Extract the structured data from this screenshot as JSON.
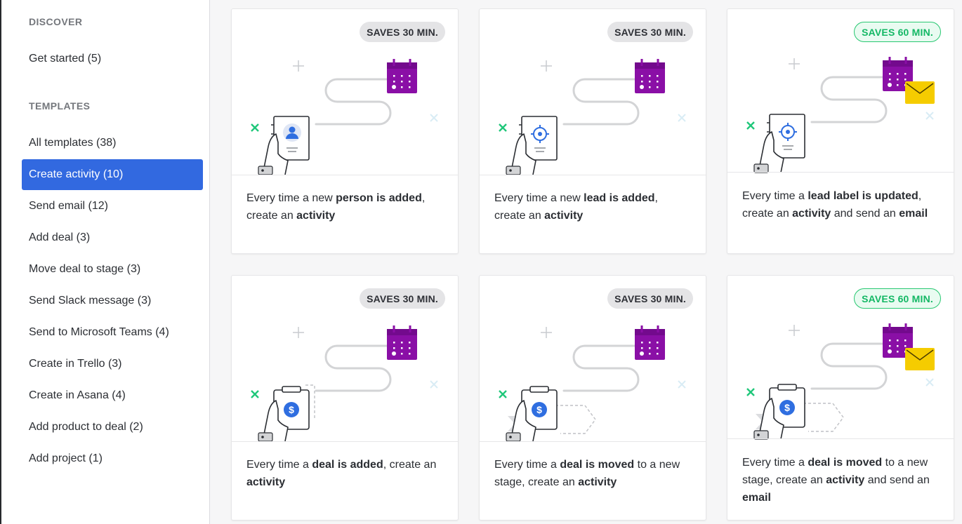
{
  "sidebar": {
    "discover_heading": "DISCOVER",
    "get_started": "Get started (5)",
    "templates_heading": "TEMPLATES",
    "items": [
      {
        "label": "All templates (38)",
        "active": false
      },
      {
        "label": "Create activity (10)",
        "active": true
      },
      {
        "label": "Send email (12)",
        "active": false
      },
      {
        "label": "Add deal (3)",
        "active": false
      },
      {
        "label": "Move deal to stage (3)",
        "active": false
      },
      {
        "label": "Send Slack message (3)",
        "active": false
      },
      {
        "label": "Send to Microsoft Teams (4)",
        "active": false
      },
      {
        "label": "Create in Trello (3)",
        "active": false
      },
      {
        "label": "Create in Asana (4)",
        "active": false
      },
      {
        "label": "Add product to deal (2)",
        "active": false
      },
      {
        "label": "Add project (1)",
        "active": false
      }
    ]
  },
  "colors": {
    "accent_blue": "#3269e0",
    "calendar_purple": "#8a0fa6",
    "email_yellow": "#f5cc00",
    "saves_green": "#14b865",
    "icon_blue": "#2f6ee0"
  },
  "cards": [
    {
      "badge": "SAVES 30 MIN.",
      "badge_style": "gray",
      "icon": "person-document-icon",
      "extra_email": false,
      "parts": [
        {
          "t": "Every time a new ",
          "b": false
        },
        {
          "t": "person is added",
          "b": true
        },
        {
          "t": ", create an ",
          "b": false
        },
        {
          "t": "activity",
          "b": true
        }
      ]
    },
    {
      "badge": "SAVES 30 MIN.",
      "badge_style": "gray",
      "icon": "lead-target-document-icon",
      "extra_email": false,
      "parts": [
        {
          "t": "Every time a new ",
          "b": false
        },
        {
          "t": "lead is added",
          "b": true
        },
        {
          "t": ", create an ",
          "b": false
        },
        {
          "t": "activity",
          "b": true
        }
      ]
    },
    {
      "badge": "SAVES 60 MIN.",
      "badge_style": "green",
      "icon": "lead-target-document-icon",
      "extra_email": true,
      "parts": [
        {
          "t": "Every time a ",
          "b": false
        },
        {
          "t": "lead label is updated",
          "b": true
        },
        {
          "t": ", create an ",
          "b": false
        },
        {
          "t": "activity",
          "b": true
        },
        {
          "t": " and send an ",
          "b": false
        },
        {
          "t": "email",
          "b": true
        }
      ]
    },
    {
      "badge": "SAVES 30 MIN.",
      "badge_style": "gray",
      "icon": "deal-dollar-clipboard-icon",
      "extra_email": false,
      "parts": [
        {
          "t": "Every time a ",
          "b": false
        },
        {
          "t": "deal is added",
          "b": true
        },
        {
          "t": ", create an ",
          "b": false
        },
        {
          "t": "activity",
          "b": true
        }
      ]
    },
    {
      "badge": "SAVES 30 MIN.",
      "badge_style": "gray",
      "icon": "deal-stage-clipboard-icon",
      "extra_email": false,
      "parts": [
        {
          "t": "Every time a ",
          "b": false
        },
        {
          "t": "deal is moved",
          "b": true
        },
        {
          "t": " to a new stage, create an ",
          "b": false
        },
        {
          "t": "activity",
          "b": true
        }
      ]
    },
    {
      "badge": "SAVES 60 MIN.",
      "badge_style": "green",
      "icon": "deal-stage-clipboard-icon",
      "extra_email": true,
      "parts": [
        {
          "t": "Every time a ",
          "b": false
        },
        {
          "t": "deal is moved",
          "b": true
        },
        {
          "t": " to a new stage, create an ",
          "b": false
        },
        {
          "t": "activity",
          "b": true
        },
        {
          "t": " and send an ",
          "b": false
        },
        {
          "t": "email",
          "b": true
        }
      ]
    }
  ]
}
